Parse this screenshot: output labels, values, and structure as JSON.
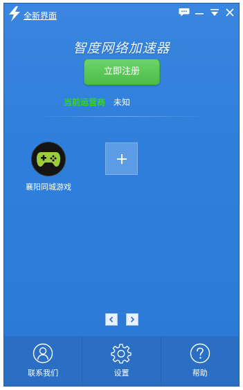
{
  "titlebar": {
    "new_ui_label": "全新界面",
    "logo_icon": "lightning-icon",
    "controls": [
      "chat-icon",
      "minimize-icon",
      "menu-dropdown-icon",
      "close-icon"
    ]
  },
  "app_title": "智度网络加速器",
  "register_label": "立即注册",
  "carrier": {
    "label": "当前运营商",
    "value": "未知"
  },
  "games": [
    {
      "label": "襄阳同城游戏",
      "icon": "gamepad-icon"
    }
  ],
  "add_tile_icon": "plus-icon",
  "pager": {
    "prev_icon": "chevron-left-icon",
    "next_icon": "chevron-right-icon"
  },
  "footer": {
    "items": [
      {
        "label": "联系我们",
        "icon": "contact-person-icon"
      },
      {
        "label": "设置",
        "icon": "gear-icon"
      },
      {
        "label": "帮助",
        "icon": "help-icon"
      }
    ]
  },
  "colors": {
    "accent_green": "#4cbc49",
    "carrier_green": "#34d61a",
    "background_blue": "#2f7fdc",
    "footer_blue": "#2a6fc4"
  }
}
